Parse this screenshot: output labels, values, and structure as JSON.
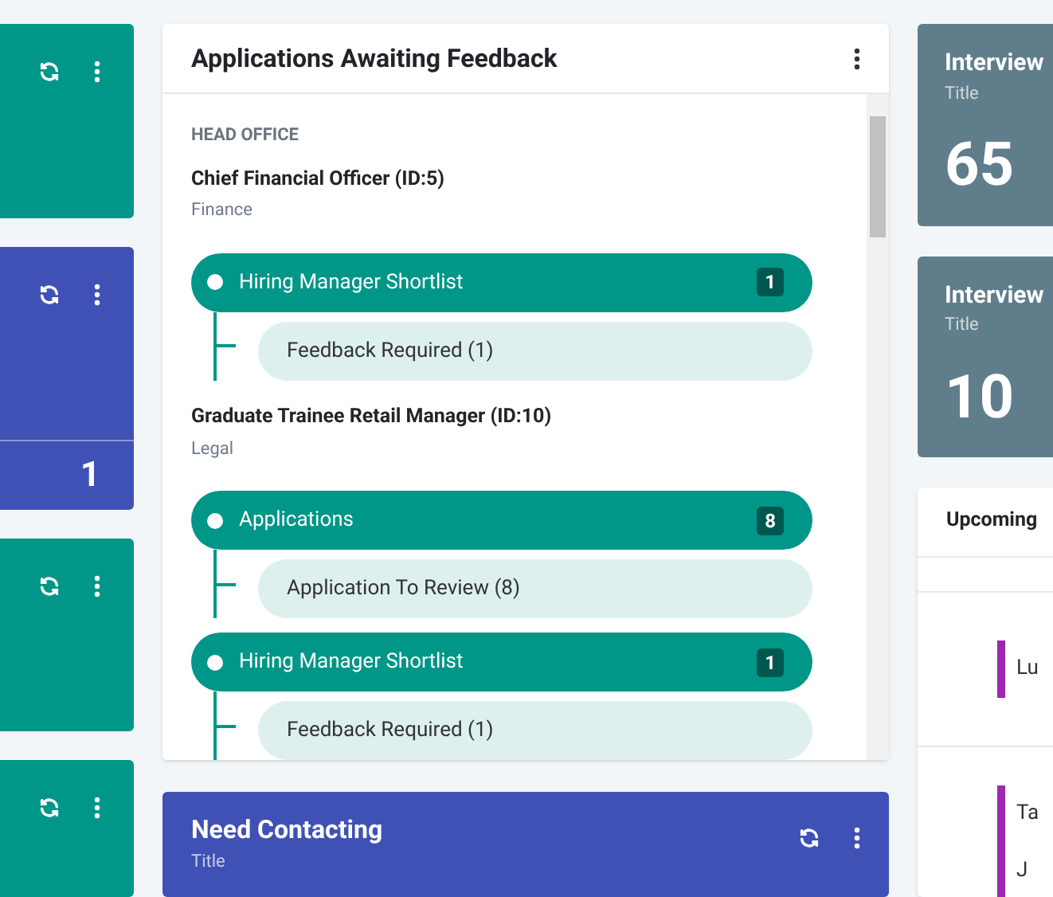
{
  "left_cards": [
    {
      "color": "#009688"
    },
    {
      "color": "#3f51b5",
      "value": "1"
    },
    {
      "color": "#009688"
    },
    {
      "color": "#009688"
    }
  ],
  "feedback_card": {
    "title": "Applications Awaiting Feedback",
    "group": "HEAD OFFICE",
    "jobs": [
      {
        "title": "Chief Financial Officer (ID:5)",
        "department": "Finance",
        "stages": [
          {
            "label": "Hiring Manager Shortlist",
            "count": "1",
            "children": [
              {
                "label": "Feedback Required (1)"
              }
            ]
          }
        ]
      },
      {
        "title": "Graduate Trainee Retail Manager (ID:10)",
        "department": "Legal",
        "stages": [
          {
            "label": "Applications",
            "count": "8",
            "children": [
              {
                "label": "Application To Review (8)"
              }
            ]
          },
          {
            "label": "Hiring Manager Shortlist",
            "count": "1",
            "children": [
              {
                "label": "Feedback Required (1)"
              }
            ]
          }
        ]
      }
    ]
  },
  "need_contacting": {
    "title": "Need Contacting",
    "subtitle": "Title"
  },
  "stat_cards": [
    {
      "title": "Interview",
      "subtitle": "Title",
      "value": "65"
    },
    {
      "title": "Interview",
      "subtitle": "Title",
      "value": "10"
    }
  ],
  "upcoming": {
    "title": "Upcoming",
    "entries": [
      {
        "label": "Lu"
      },
      {
        "label": "Ta"
      },
      {
        "label": "J"
      }
    ]
  }
}
